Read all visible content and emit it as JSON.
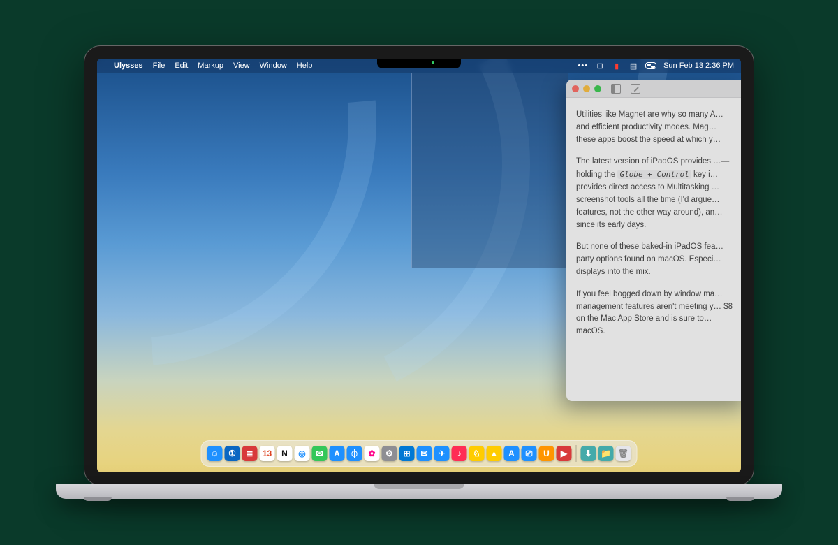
{
  "menubar": {
    "app_name": "Ulysses",
    "menus": [
      "File",
      "Edit",
      "Markup",
      "View",
      "Window",
      "Help"
    ],
    "status": {
      "datetime": "Sun Feb 13  2:36 PM"
    }
  },
  "window": {
    "paragraphs": {
      "p1": "Utilities like Magnet are why so many A… and efficient productivity modes. Mag… these apps boost the speed at which y…",
      "p2_a": "The latest version of iPadOS provides …— holding the ",
      "p2_kbd": "Globe + Control",
      "p2_b": " key i… provides direct access to Multitasking … screenshot tools all the time (I'd argue… features, not the other way around), an… since its early days.",
      "p3": "But none of these baked-in iPadOS fea… party options found on macOS. Especi… displays into the mix.",
      "p4": "If you feel bogged down by window ma… management features aren't meeting y… $8 on the Mac App Store and is sure to… macOS."
    }
  },
  "dock": {
    "apps": [
      {
        "name": "finder",
        "bg": "#1e90ff",
        "glyph": "☺"
      },
      {
        "name": "1password",
        "bg": "#0a66c2",
        "glyph": "①"
      },
      {
        "name": "things",
        "bg": "#d83a3a",
        "glyph": "≣"
      },
      {
        "name": "fantastical",
        "bg": "#ffffff",
        "glyph": "13",
        "fg": "#d42"
      },
      {
        "name": "notion",
        "bg": "#ffffff",
        "glyph": "N",
        "fg": "#111"
      },
      {
        "name": "safari",
        "bg": "#ffffff",
        "glyph": "◎",
        "fg": "#1e90ff"
      },
      {
        "name": "messages",
        "bg": "#34c759",
        "glyph": "✉"
      },
      {
        "name": "appstore",
        "bg": "#1e90ff",
        "glyph": "A"
      },
      {
        "name": "activity",
        "bg": "#1e90ff",
        "glyph": "⏀"
      },
      {
        "name": "photos",
        "bg": "#ffffff",
        "glyph": "✿",
        "fg": "#f08"
      },
      {
        "name": "settings",
        "bg": "#8e8e93",
        "glyph": "⚙"
      },
      {
        "name": "windows",
        "bg": "#0078d4",
        "glyph": "⊞"
      },
      {
        "name": "mail",
        "bg": "#1e90ff",
        "glyph": "✉"
      },
      {
        "name": "spark",
        "bg": "#1e90ff",
        "glyph": "✈"
      },
      {
        "name": "music",
        "bg": "#ff2d55",
        "glyph": "♪"
      },
      {
        "name": "bear",
        "bg": "#ffcc00",
        "glyph": "♘"
      },
      {
        "name": "basecamp",
        "bg": "#ffcc00",
        "glyph": "▲"
      },
      {
        "name": "appstore2",
        "bg": "#1e90ff",
        "glyph": "A"
      },
      {
        "name": "cleanshot",
        "bg": "#1e90ff",
        "glyph": "⎚"
      },
      {
        "name": "ulysses",
        "bg": "#ff9500",
        "glyph": "U"
      },
      {
        "name": "screenflow",
        "bg": "#d83a3a",
        "glyph": "▶"
      }
    ],
    "right": [
      {
        "name": "downloads",
        "bg": "#4aa",
        "glyph": "⬇"
      },
      {
        "name": "folder",
        "bg": "#4aa",
        "glyph": "📁"
      },
      {
        "name": "trash",
        "bg": "#e5e5ea",
        "glyph": "🗑",
        "fg": "#888"
      }
    ]
  }
}
